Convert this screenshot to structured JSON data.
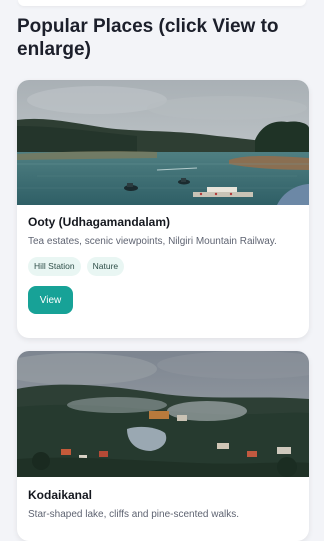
{
  "page": {
    "title": "Popular Places (click View to enlarge)"
  },
  "places": [
    {
      "name": "Ooty (Udhagamandalam)",
      "description": "Tea estates, scenic viewpoints, Nilgiri Mountain Railway.",
      "tags": [
        "Hill Station",
        "Nature"
      ],
      "view_label": "View"
    },
    {
      "name": "Kodaikanal",
      "description": "Star-shaped lake, cliffs and pine-scented walks."
    }
  ],
  "colors": {
    "accent": "#17a297",
    "tag_background": "#e9f6f3",
    "page_background": "#f3f4f8"
  }
}
